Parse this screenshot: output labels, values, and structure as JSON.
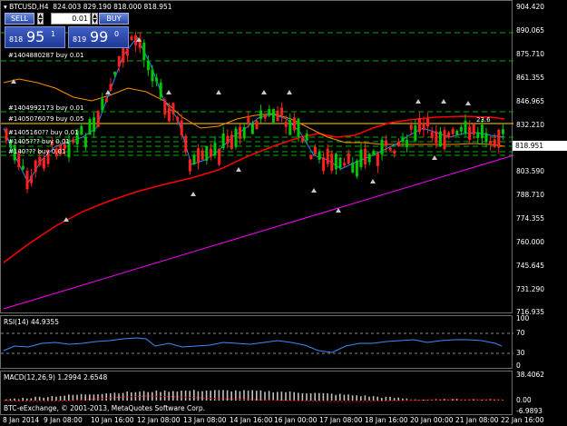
{
  "header": {
    "symbol_line": "BTCUSD,H4",
    "ohlc": "824.003 829.190 818.000 818.951"
  },
  "trade_panel": {
    "sell_label": "SELL",
    "buy_label": "BUY",
    "lot_value": "0.01",
    "bid_small": "818",
    "bid_big": "95",
    "bid_sup": "1",
    "ask_small": "819",
    "ask_big": "99",
    "ask_sup": "0"
  },
  "orders": [
    {
      "label": "#1404880287 buy 0.01"
    },
    {
      "label": "#1404992173 buy 0.01"
    },
    {
      "label": "#1405076079 buy 0.05"
    },
    {
      "label": "#1405160?? buy 0.01"
    },
    {
      "label": "#1405??? buy 0.01"
    },
    {
      "label": "#140??? buy 0.01"
    }
  ],
  "annotation": "23.6",
  "current_price": "818.951",
  "price_axis": [
    "904.420",
    "890.065",
    "875.710",
    "861.355",
    "846.965",
    "832.210",
    "818.951",
    "803.590",
    "788.710",
    "774.355",
    "760.000",
    "745.645",
    "731.290",
    "716.935"
  ],
  "rsi": {
    "title": "RSI(14) 44.9355",
    "levels": [
      "100",
      "70",
      "30",
      "0"
    ]
  },
  "macd": {
    "title": "MACD(12,26,9) 1.2994 2.6548",
    "levels": [
      "38.4062",
      "0.00",
      "-6.9893"
    ]
  },
  "footer": {
    "copyright": "BTC-eExchange, © 2001-2013, MetaQuotes Software Corp."
  },
  "time_axis": [
    "8 Jan 2014",
    "9 Jan 08:00",
    "10 Jan 16:00",
    "12 Jan 08:00",
    "13 Jan 08:00",
    "14 Jan 16:00",
    "16 Jan 00:00",
    "17 Jan 08:00",
    "18 Jan 16:00",
    "20 Jan 00:00",
    "21 Jan 08:00",
    "22 Jan 16:00"
  ],
  "colors": {
    "background": "#000000",
    "bull": "#00c800",
    "bear": "#ff2020",
    "ma_red": "#ff0000",
    "ma_orange": "#ff8c00",
    "ma_blue": "#1e90ff",
    "trend": "#ff00ff",
    "fib": "#ffd700",
    "order_line": "#00b000",
    "rsi_line": "#3b8bff",
    "macd_hist": "#c0c0c0",
    "macd_signal": "#ff0000"
  }
}
